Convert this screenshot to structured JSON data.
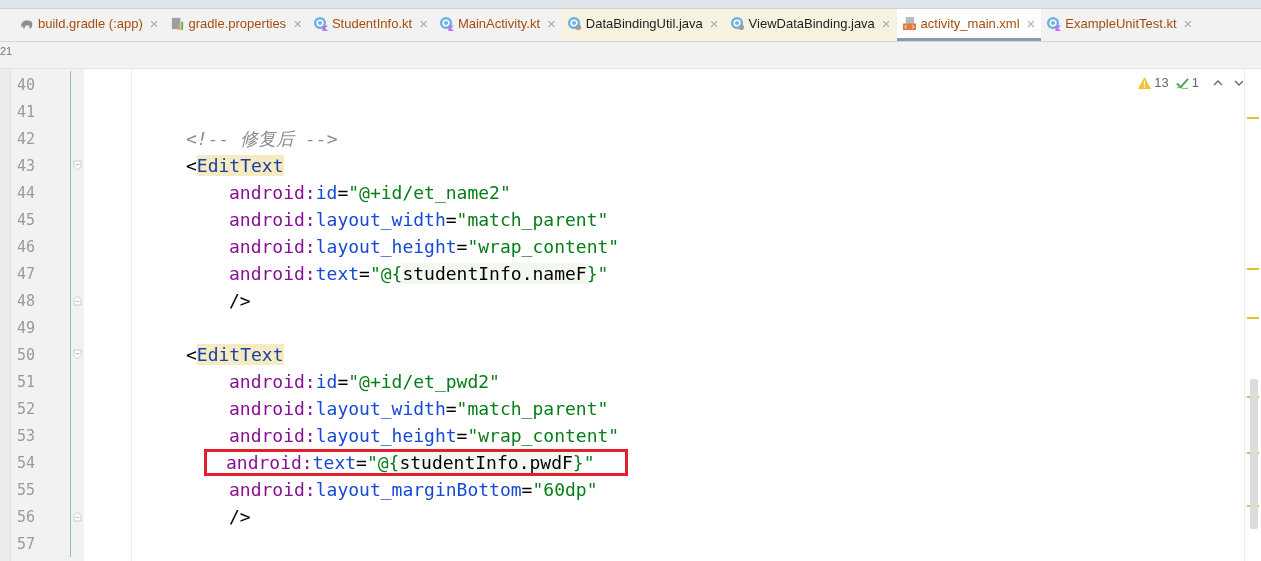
{
  "tabs": [
    {
      "label": "build.gradle (:app)",
      "kind": "gradle",
      "close": "×",
      "modified": true,
      "readonly": false,
      "selected": false
    },
    {
      "label": "gradle.properties",
      "kind": "properties",
      "close": "×",
      "modified": true,
      "readonly": false,
      "selected": false
    },
    {
      "label": "StudentInfo.kt",
      "kind": "kotlin",
      "close": "×",
      "modified": true,
      "readonly": false,
      "selected": false
    },
    {
      "label": "MainActivity.kt",
      "kind": "kotlin",
      "close": "×",
      "modified": true,
      "readonly": false,
      "selected": false
    },
    {
      "label": "DataBindingUtil.java",
      "kind": "java",
      "close": "×",
      "modified": false,
      "readonly": true,
      "selected": false
    },
    {
      "label": "ViewDataBinding.java",
      "kind": "java",
      "close": "×",
      "modified": false,
      "readonly": true,
      "selected": false
    },
    {
      "label": "activity_main.xml",
      "kind": "xml",
      "close": "×",
      "modified": true,
      "readonly": false,
      "selected": true
    },
    {
      "label": "ExampleUnitTest.kt",
      "kind": "kotlin",
      "close": "×",
      "modified": true,
      "readonly": false,
      "selected": false
    }
  ],
  "side_label": "21",
  "inspections": {
    "warnings": "13",
    "weak_warnings": "1"
  },
  "lines": [
    {
      "number": "40",
      "kind": "blank"
    },
    {
      "number": "41",
      "kind": "blank"
    },
    {
      "number": "42",
      "kind": "comment",
      "boxed": false,
      "tokens": [
        {
          "kind": "comment",
          "s": "<!-- 修复后 -->"
        }
      ]
    },
    {
      "number": "43",
      "kind": "open_tag",
      "boxed": false,
      "tokens": [
        {
          "kind": "punct",
          "s": "<"
        },
        {
          "kind": "tag",
          "s": "EditText"
        }
      ]
    },
    {
      "number": "44",
      "kind": "attribute",
      "boxed": false,
      "tokens": [
        {
          "kind": "ns",
          "s": "android:"
        },
        {
          "kind": "attr",
          "s": "id"
        },
        {
          "kind": "punct",
          "s": "="
        },
        {
          "kind": "str",
          "s": "\"@+id/et_name2\""
        }
      ]
    },
    {
      "number": "45",
      "kind": "attribute",
      "boxed": false,
      "tokens": [
        {
          "kind": "ns",
          "s": "android:"
        },
        {
          "kind": "attr",
          "s": "layout_width"
        },
        {
          "kind": "punct",
          "s": "="
        },
        {
          "kind": "str",
          "s": "\"match_parent\""
        }
      ]
    },
    {
      "number": "46",
      "kind": "attribute",
      "boxed": false,
      "tokens": [
        {
          "kind": "ns",
          "s": "android:"
        },
        {
          "kind": "attr",
          "s": "layout_height"
        },
        {
          "kind": "punct",
          "s": "="
        },
        {
          "kind": "str",
          "s": "\"wrap_content\""
        }
      ]
    },
    {
      "number": "47",
      "kind": "attribute",
      "boxed": false,
      "tokens": [
        {
          "kind": "ns",
          "s": "android:"
        },
        {
          "kind": "attr",
          "s": "text"
        },
        {
          "kind": "punct",
          "s": "="
        },
        {
          "kind": "str",
          "s": "\"@{"
        },
        {
          "kind": "expr",
          "s": "studentInfo.nameF"
        },
        {
          "kind": "str",
          "s": "}\""
        }
      ]
    },
    {
      "number": "48",
      "kind": "close_tag",
      "boxed": false,
      "tokens": [
        {
          "kind": "punct",
          "s": "/>"
        }
      ]
    },
    {
      "number": "49",
      "kind": "blank"
    },
    {
      "number": "50",
      "kind": "open_tag",
      "boxed": false,
      "tokens": [
        {
          "kind": "punct",
          "s": "<"
        },
        {
          "kind": "tag",
          "s": "EditText"
        }
      ]
    },
    {
      "number": "51",
      "kind": "attribute",
      "boxed": false,
      "tokens": [
        {
          "kind": "ns",
          "s": "android:"
        },
        {
          "kind": "attr",
          "s": "id"
        },
        {
          "kind": "punct",
          "s": "="
        },
        {
          "kind": "str",
          "s": "\"@+id/et_pwd2\""
        }
      ]
    },
    {
      "number": "52",
      "kind": "attribute",
      "boxed": false,
      "tokens": [
        {
          "kind": "ns",
          "s": "android:"
        },
        {
          "kind": "attr",
          "s": "layout_width"
        },
        {
          "kind": "punct",
          "s": "="
        },
        {
          "kind": "str",
          "s": "\"match_parent\""
        }
      ]
    },
    {
      "number": "53",
      "kind": "attribute",
      "boxed": false,
      "tokens": [
        {
          "kind": "ns",
          "s": "android:"
        },
        {
          "kind": "attr",
          "s": "layout_height"
        },
        {
          "kind": "punct",
          "s": "="
        },
        {
          "kind": "str",
          "s": "\"wrap_content\""
        }
      ]
    },
    {
      "number": "54",
      "kind": "attribute",
      "boxed": true,
      "tokens": [
        {
          "kind": "ns",
          "s": "android:"
        },
        {
          "kind": "attr",
          "s": "text"
        },
        {
          "kind": "punct",
          "s": "="
        },
        {
          "kind": "str",
          "s": "\"@{"
        },
        {
          "kind": "expr",
          "s": "studentInfo.pwdF"
        },
        {
          "kind": "str",
          "s": "}\""
        }
      ]
    },
    {
      "number": "55",
      "kind": "attribute",
      "boxed": false,
      "tokens": [
        {
          "kind": "ns",
          "s": "android:"
        },
        {
          "kind": "attr",
          "s": "layout_marginBottom"
        },
        {
          "kind": "punct",
          "s": "="
        },
        {
          "kind": "str",
          "s": "\"60dp\""
        }
      ]
    },
    {
      "number": "56",
      "kind": "close_tag",
      "boxed": false,
      "tokens": [
        {
          "kind": "punct",
          "s": "/>"
        }
      ]
    },
    {
      "number": "57",
      "kind": "blank"
    }
  ]
}
